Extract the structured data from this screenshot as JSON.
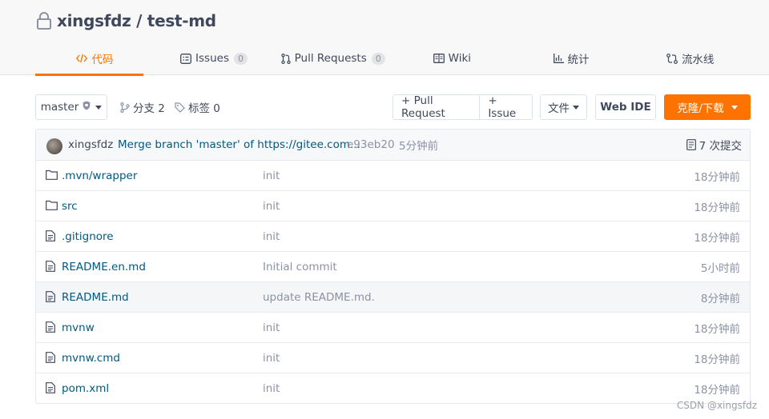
{
  "repo": {
    "owner_repo": "xingsfdz / test-md"
  },
  "tabs": [
    {
      "label": "代码",
      "icon": "code-icon",
      "active": true
    },
    {
      "label": "Issues",
      "icon": "issues-icon",
      "count": "0"
    },
    {
      "label": "Pull Requests",
      "icon": "pull-request-icon",
      "count": "0"
    },
    {
      "label": "Wiki",
      "icon": "wiki-icon"
    },
    {
      "label": "统计",
      "icon": "stats-icon"
    },
    {
      "label": "流水线",
      "icon": "pipeline-icon"
    }
  ],
  "toolbar": {
    "branch": "master",
    "branches_label": "分支 2",
    "tags_label": "标签 0",
    "pull_request_label": "+ Pull Request",
    "issue_label": "+ Issue",
    "file_label": "文件",
    "web_ide_label": "Web IDE",
    "clone_label": "克隆/下载"
  },
  "commit": {
    "author": "xingsfdz",
    "message": "Merge branch 'master' of https://gitee.com...",
    "sha": "e93eb20",
    "time": "5分钟前",
    "count_label": "7 次提交"
  },
  "files": [
    {
      "name": ".mvn/wrapper",
      "type": "folder",
      "message": "init",
      "time": "18分钟前"
    },
    {
      "name": "src",
      "type": "folder",
      "message": "init",
      "time": "18分钟前"
    },
    {
      "name": ".gitignore",
      "type": "file",
      "message": "init",
      "time": "18分钟前"
    },
    {
      "name": "README.en.md",
      "type": "file",
      "message": "Initial commit",
      "time": "5小时前"
    },
    {
      "name": "README.md",
      "type": "file",
      "message": "update README.md.",
      "time": "8分钟前"
    },
    {
      "name": "mvnw",
      "type": "file",
      "message": "init",
      "time": "18分钟前"
    },
    {
      "name": "mvnw.cmd",
      "type": "file",
      "message": "init",
      "time": "18分钟前"
    },
    {
      "name": "pom.xml",
      "type": "file",
      "message": "init",
      "time": "18分钟前"
    }
  ],
  "watermark": "CSDN @xingsfdz",
  "colors": {
    "accent": "#fe7300",
    "link": "#005980",
    "muted": "#8c92a4"
  }
}
